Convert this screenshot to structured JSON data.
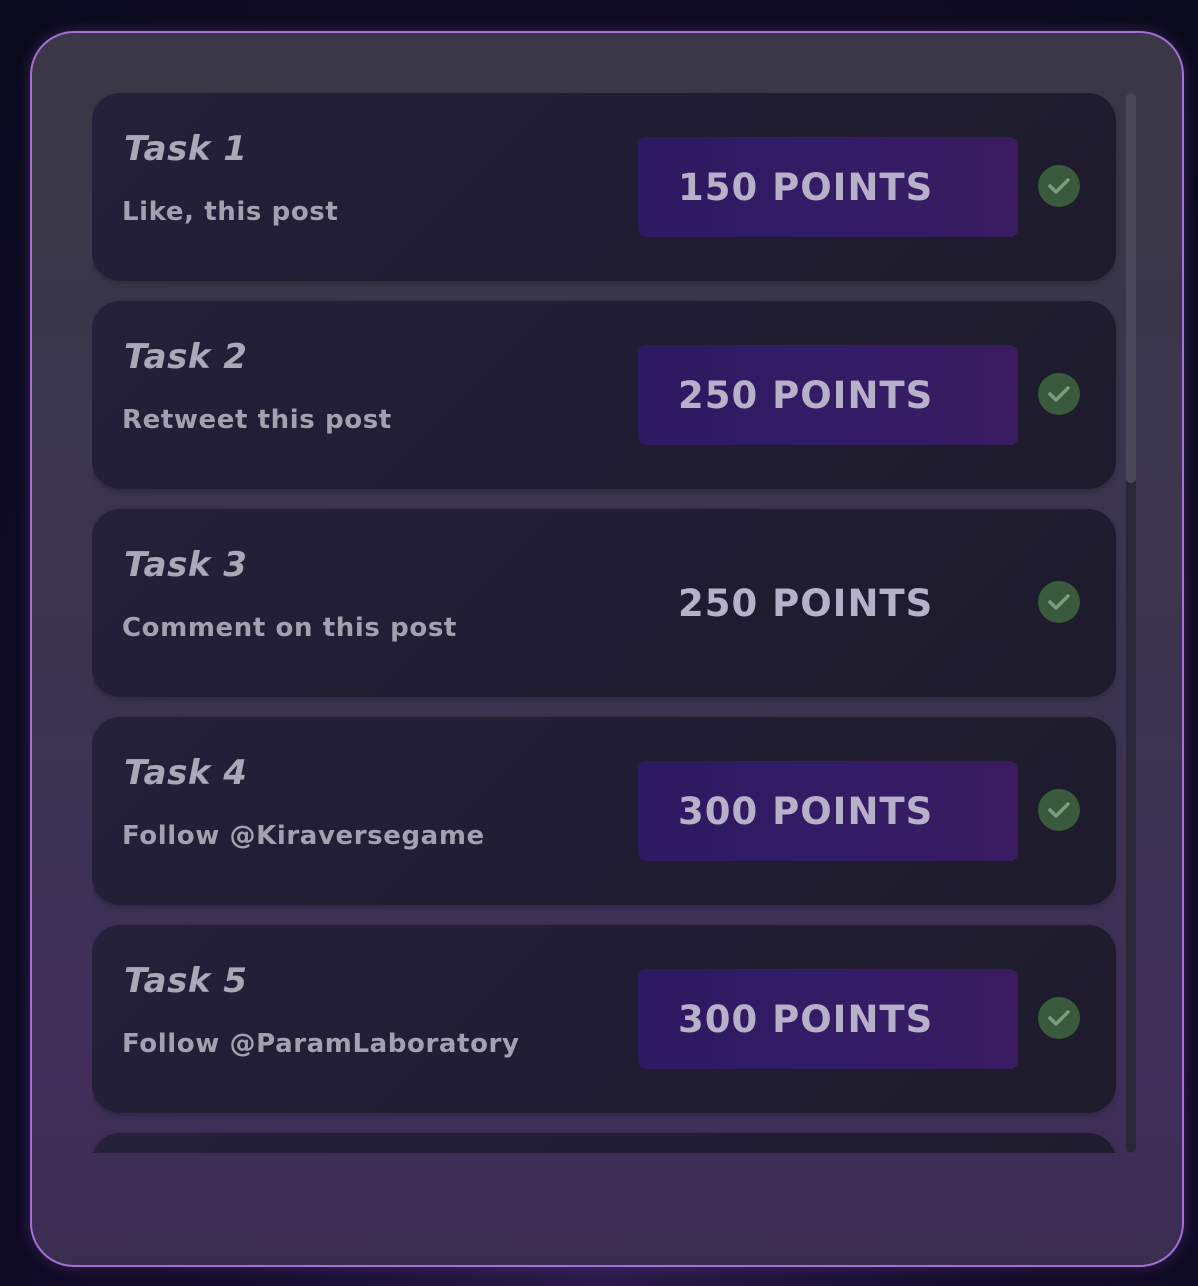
{
  "tasks": [
    {
      "title": "Task 1",
      "description": "Like, this post",
      "points": "150 POINTS",
      "highlighted": true
    },
    {
      "title": "Task 2",
      "description": "Retweet this post",
      "points": "250 POINTS",
      "highlighted": true
    },
    {
      "title": "Task 3",
      "description": "Comment on this post",
      "points": "250 POINTS",
      "highlighted": false
    },
    {
      "title": "Task 4",
      "description": "Follow @Kiraversegame",
      "points": "300 POINTS",
      "highlighted": true
    },
    {
      "title": "Task 5",
      "description": "Follow @ParamLaboratory",
      "points": "300 POINTS",
      "highlighted": true
    }
  ],
  "colors": {
    "accent_border": "#a86ed8",
    "points_bg": "#2c1a62",
    "check_bg": "#3a5a3e",
    "check_mark": "#7e9a80"
  },
  "icons": {
    "check": "check-icon"
  }
}
